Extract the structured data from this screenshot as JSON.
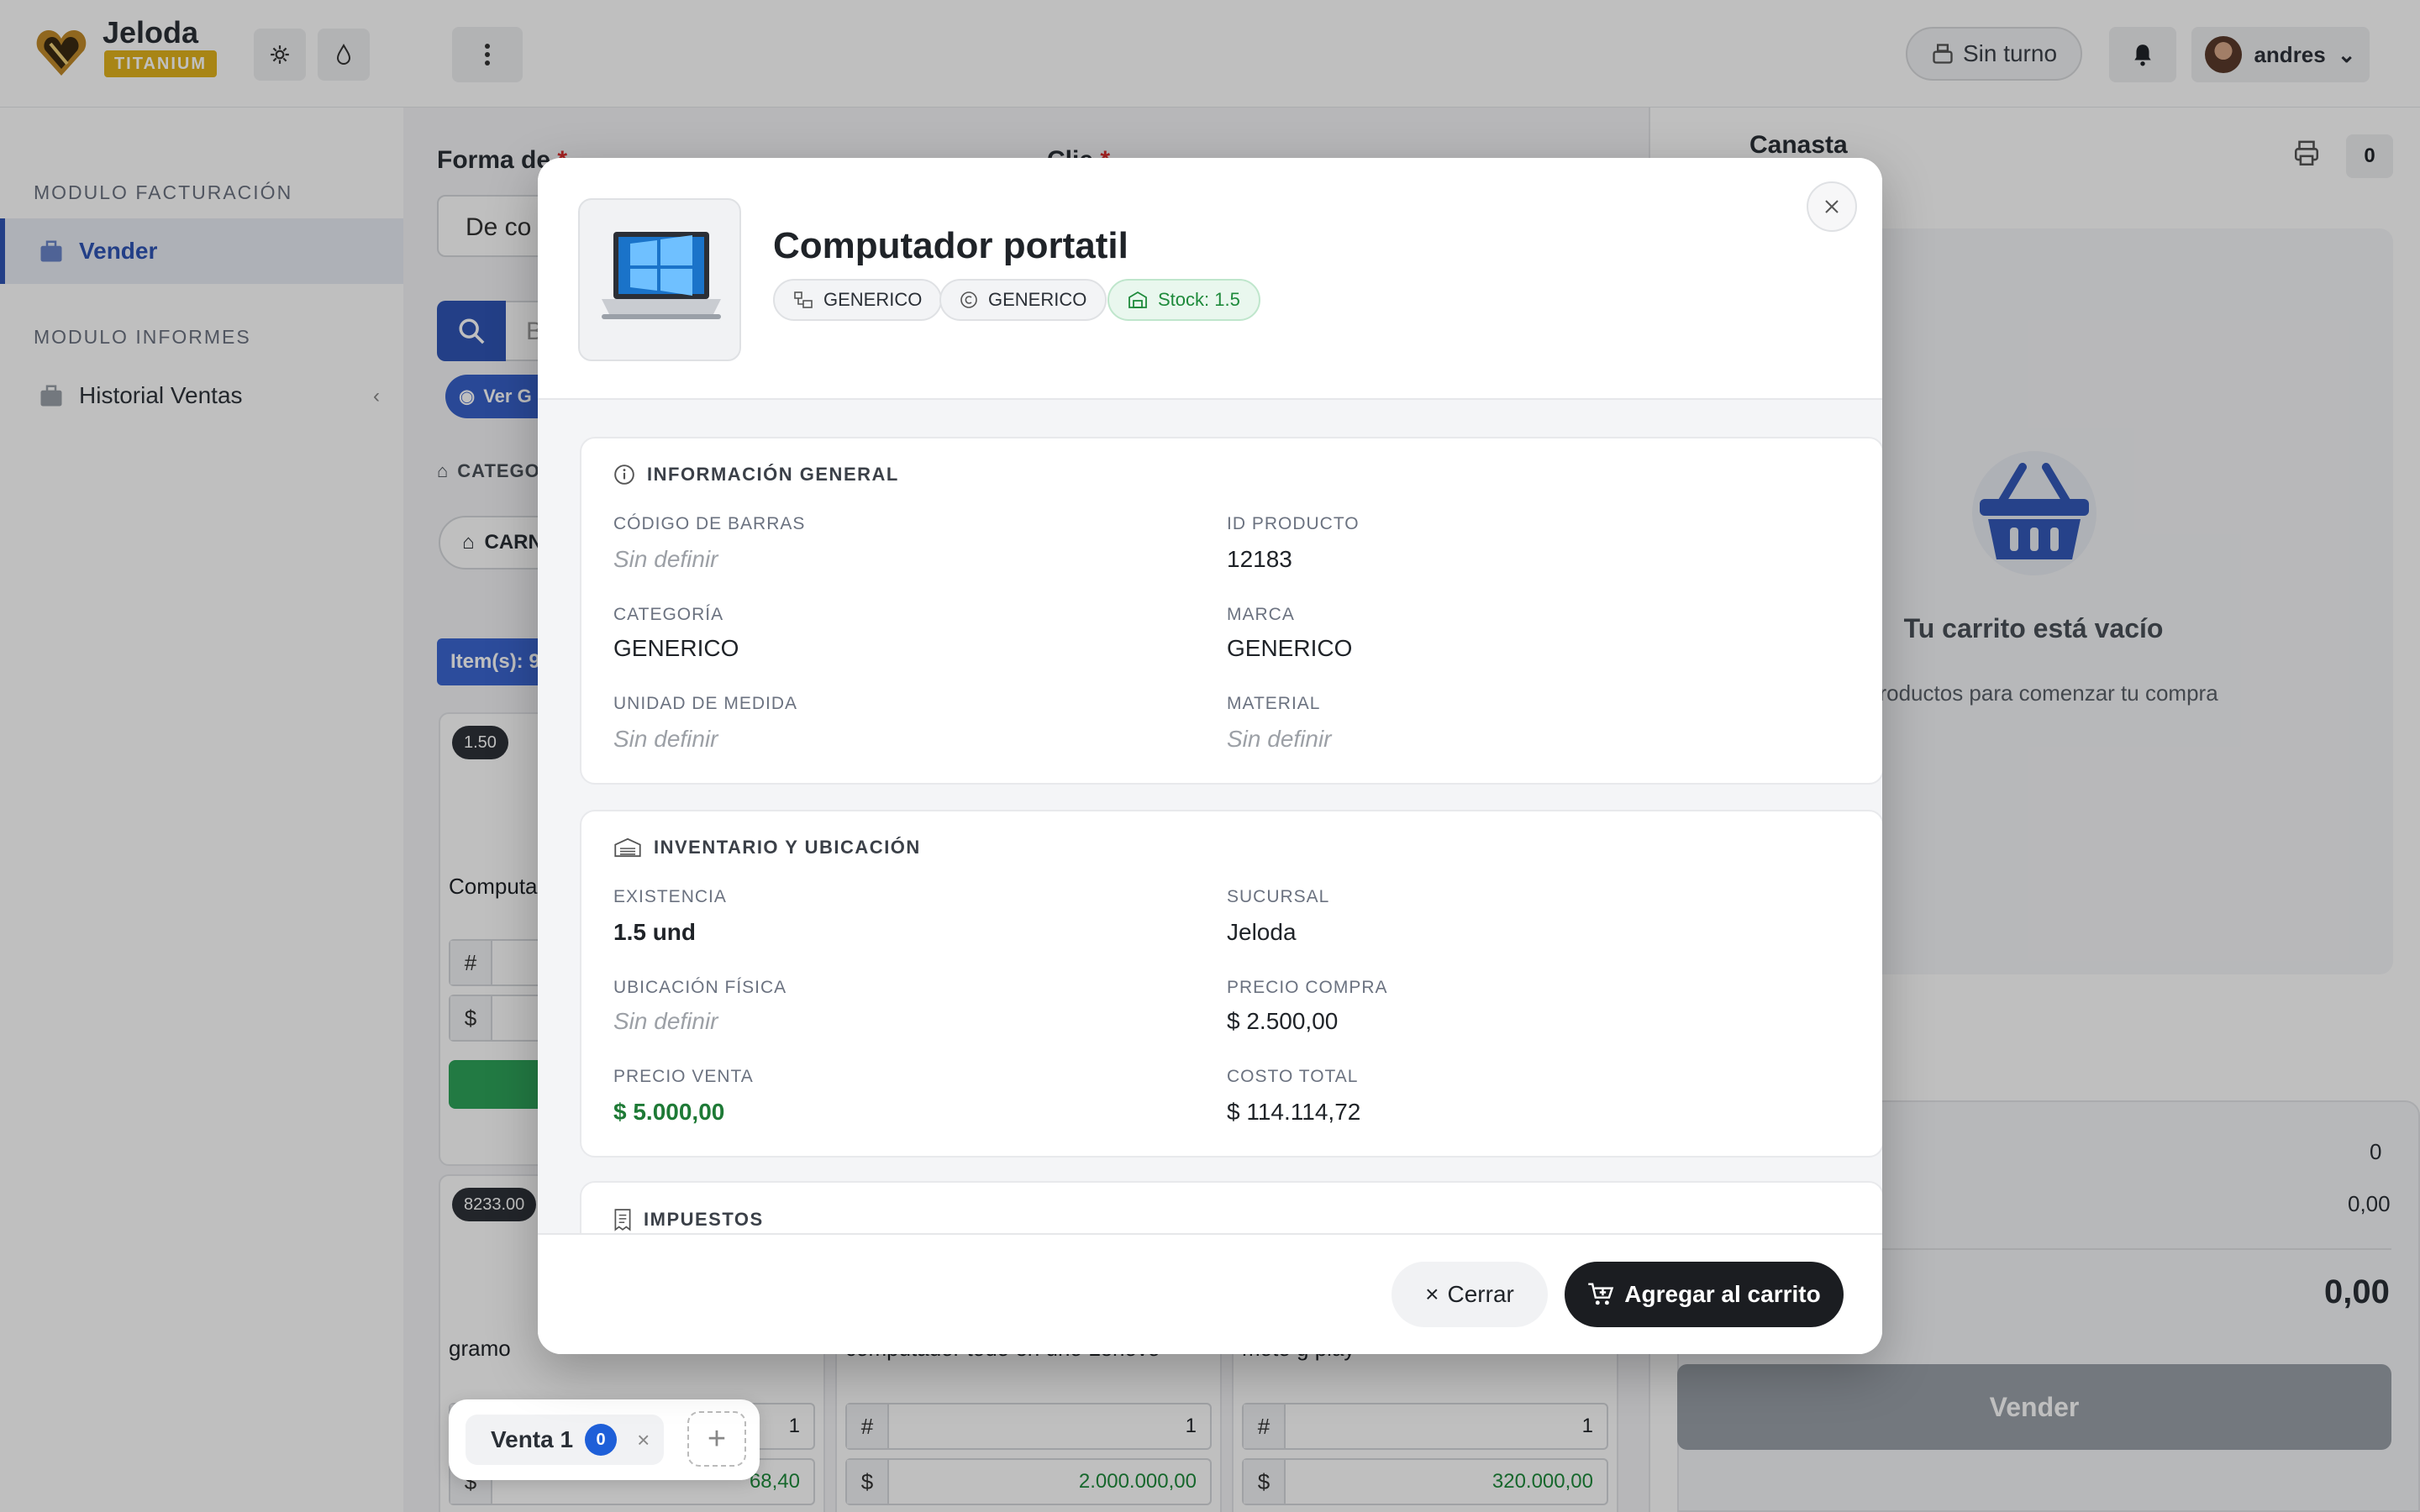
{
  "brand": {
    "name": "Jeloda",
    "badge": "TITANIUM"
  },
  "header": {
    "shift_label": "Sin turno",
    "user_name": "andres"
  },
  "sidebar": {
    "section1": "MODULO FACTURACIÓN",
    "item_vender": "Vender",
    "section2": "MODULO INFORMES",
    "item_historial": "Historial Ventas"
  },
  "main": {
    "forma_label": "Forma de",
    "forma_value": "De co",
    "cliente_label": "Clie",
    "search_placeholder": "B",
    "ver_button": "Ver G",
    "categories_label": "CATEGO",
    "category_chip": "CARN",
    "items_pill": "Item(s): 9",
    "products": [
      {
        "tag": "1.50",
        "name": "Computa",
        "qty_prefix": "#",
        "price_prefix": "$"
      },
      {
        "tag": "8233.00",
        "name": "gramo",
        "qty": "1",
        "price": "68,40"
      },
      {
        "name": "computador todo en uno Lenovo",
        "qty": "1",
        "price": "2.000.000,00"
      },
      {
        "name": "moto g play",
        "qty": "1",
        "price": "320.000,00"
      }
    ],
    "sale_tab": {
      "label": "Venta 1",
      "count": "0"
    }
  },
  "cart": {
    "title": "Canasta",
    "count": "0",
    "empty_title": "Tu carrito está vacío",
    "empty_sub": "e productos para comenzar tu compra",
    "items_value": "0",
    "subtotal_value": "0,00",
    "total_value": "0,00",
    "sell_button": "Vender"
  },
  "modal": {
    "title": "Computador portatil",
    "chip_category": "GENERICO",
    "chip_brand": "GENERICO",
    "chip_stock": "Stock: 1.5",
    "general": {
      "title": "INFORMACIÓN GENERAL",
      "barcode_label": "CÓDIGO DE BARRAS",
      "barcode_value": "Sin definir",
      "id_label": "ID PRODUCTO",
      "id_value": "12183",
      "category_label": "CATEGORÍA",
      "category_value": "GENERICO",
      "brand_label": "MARCA",
      "brand_value": "GENERICO",
      "unit_label": "UNIDAD DE MEDIDA",
      "unit_value": "Sin definir",
      "material_label": "MATERIAL",
      "material_value": "Sin definir"
    },
    "inventory": {
      "title": "INVENTARIO Y UBICACIÓN",
      "existence_label": "EXISTENCIA",
      "existence_value": "1.5 und",
      "branch_label": "SUCURSAL",
      "branch_value": "Jeloda",
      "location_label": "UBICACIÓN FÍSICA",
      "location_value": "Sin definir",
      "buy_price_label": "PRECIO COMPRA",
      "buy_price_value": "$ 2.500,00",
      "sell_price_label": "PRECIO VENTA",
      "sell_price_value": "$ 5.000,00",
      "total_cost_label": "COSTO TOTAL",
      "total_cost_value": "$ 114.114,72"
    },
    "taxes": {
      "title": "IMPUESTOS"
    },
    "close_button": "Cerrar",
    "add_button": "Agregar al carrito"
  }
}
